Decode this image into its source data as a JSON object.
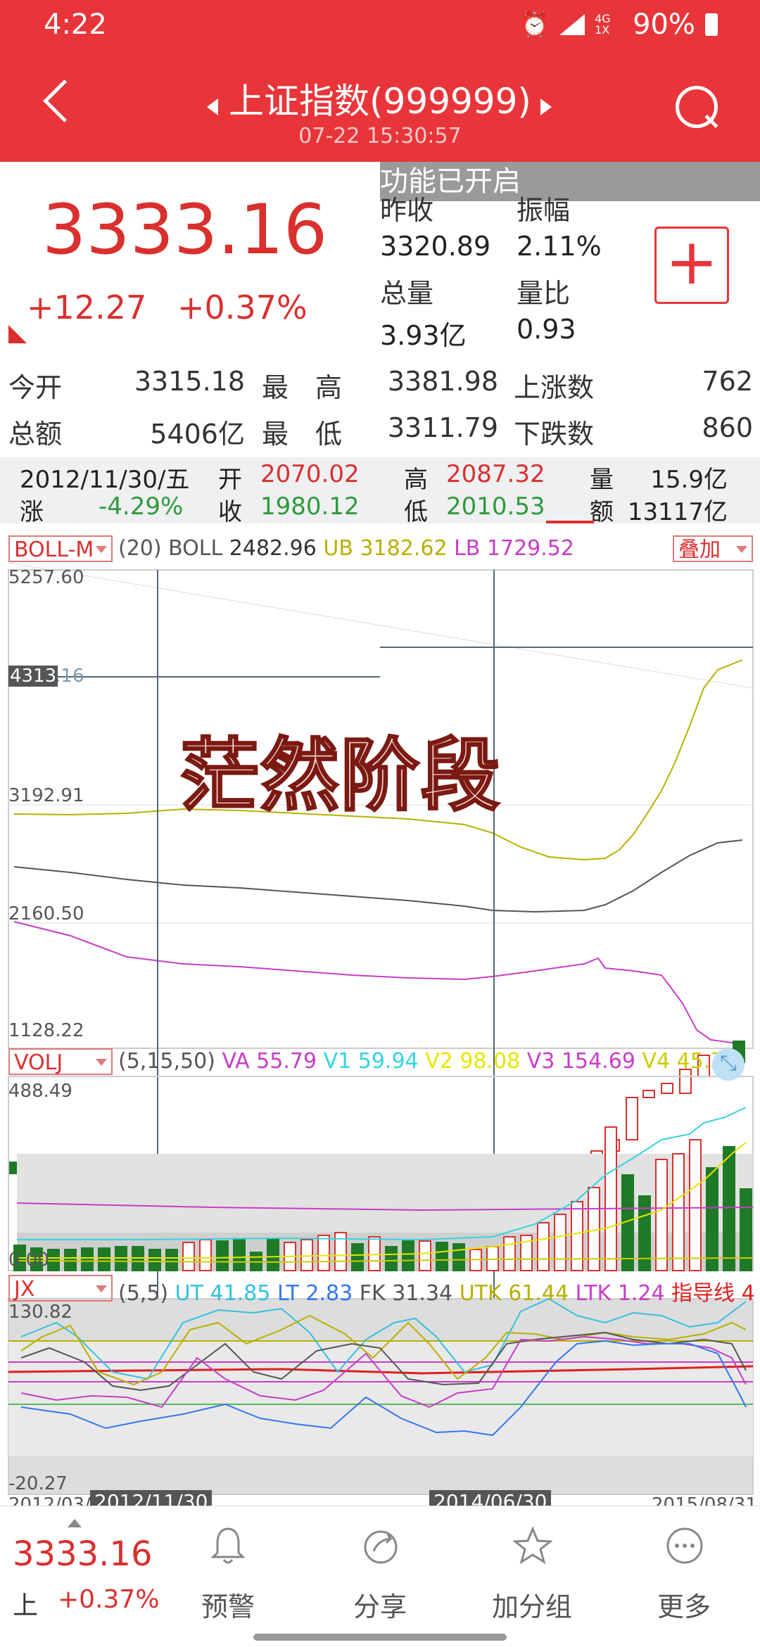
{
  "status": {
    "time": "4:22",
    "network": "4G 1X",
    "battery": "90%"
  },
  "header": {
    "title": "上证指数(999999)",
    "subtitle": "07-22 15:30:57"
  },
  "toast": "功能已开启",
  "quote": {
    "price": "3333.16",
    "change": "+12.27",
    "change_pct": "+0.37%",
    "prev_close_label": "昨收",
    "prev_close": "3320.89",
    "amplitude_label": "振幅",
    "amplitude": "2.11%",
    "volume_label": "总量",
    "volume": "3.93亿",
    "ratio_label": "量比",
    "ratio": "0.93",
    "add_label": "+"
  },
  "stats": {
    "open_label": "今开",
    "open": "3315.18",
    "high_label": "最　高",
    "high": "3381.98",
    "up_label": "上涨数",
    "up": "762",
    "amount_label": "总额",
    "amount": "5406亿",
    "low_label": "最　低",
    "low": "3311.79",
    "down_label": "下跌数",
    "down": "860"
  },
  "history": {
    "date": "2012/11/30/五",
    "open_label": "开",
    "open": "2070.02",
    "high_label": "高",
    "high": "2087.32",
    "vol_label": "量",
    "vol": "15.9亿",
    "chg_label": "涨",
    "chg": "-4.29%",
    "close_label": "收",
    "close": "1980.12",
    "low_label": "低",
    "low": "2010.53",
    "amt_label": "额",
    "amt": "13117亿"
  },
  "boll": {
    "select": "BOLL-M",
    "param": "(20) BOLL",
    "boll": "2482.96",
    "ub_label": "UB",
    "ub": "3182.62",
    "lb_label": "LB",
    "lb": "1729.52",
    "overlay": "叠加",
    "y_top": "5257.60",
    "y_cross": "4313.16",
    "y_cross_short": "4313",
    "y_mid": "3192.91",
    "y_low": "2160.50",
    "y_bottom": "1128.22",
    "watermark": "茫然阶段"
  },
  "vol": {
    "select": "VOLJ",
    "param": "(5,15,50)",
    "va_label": "VA",
    "va": "55.79",
    "v1_label": "V1",
    "v1": "59.94",
    "v2_label": "V2",
    "v2": "98.08",
    "v3_label": "V3",
    "v3": "154.69",
    "v4_label": "V4",
    "v4": "45.31",
    "y_top": "488.49",
    "y_bottom": "0.00"
  },
  "jx": {
    "select": "JX",
    "param": "(5,5)",
    "ut_label": "UT",
    "ut": "41.85",
    "lt_label": "LT",
    "lt": "2.83",
    "fk_label": "FK",
    "fk": "31.34",
    "utk_label": "UTK",
    "utk": "61.44",
    "ltk_label": "LTK",
    "ltk": "1.24",
    "guide": "指导线 4",
    "y_top": "130.82",
    "y_bottom": "-20.27"
  },
  "xaxis": {
    "start": "2012/03/",
    "cross1": "2012/11/30",
    "cross2": "2014/06/30",
    "end": "2015/08/31"
  },
  "bottom": {
    "price": "3333.16",
    "prefix": "上",
    "pct": "+0.37%",
    "tabs": [
      "预警",
      "分享",
      "加分组",
      "更多"
    ]
  },
  "colors": {
    "brand": "#e8353a",
    "up": "#d9302e",
    "down": "#1e7a26",
    "ub": "#b8b000",
    "lb": "#c83cc8",
    "mid": "#555555"
  }
}
